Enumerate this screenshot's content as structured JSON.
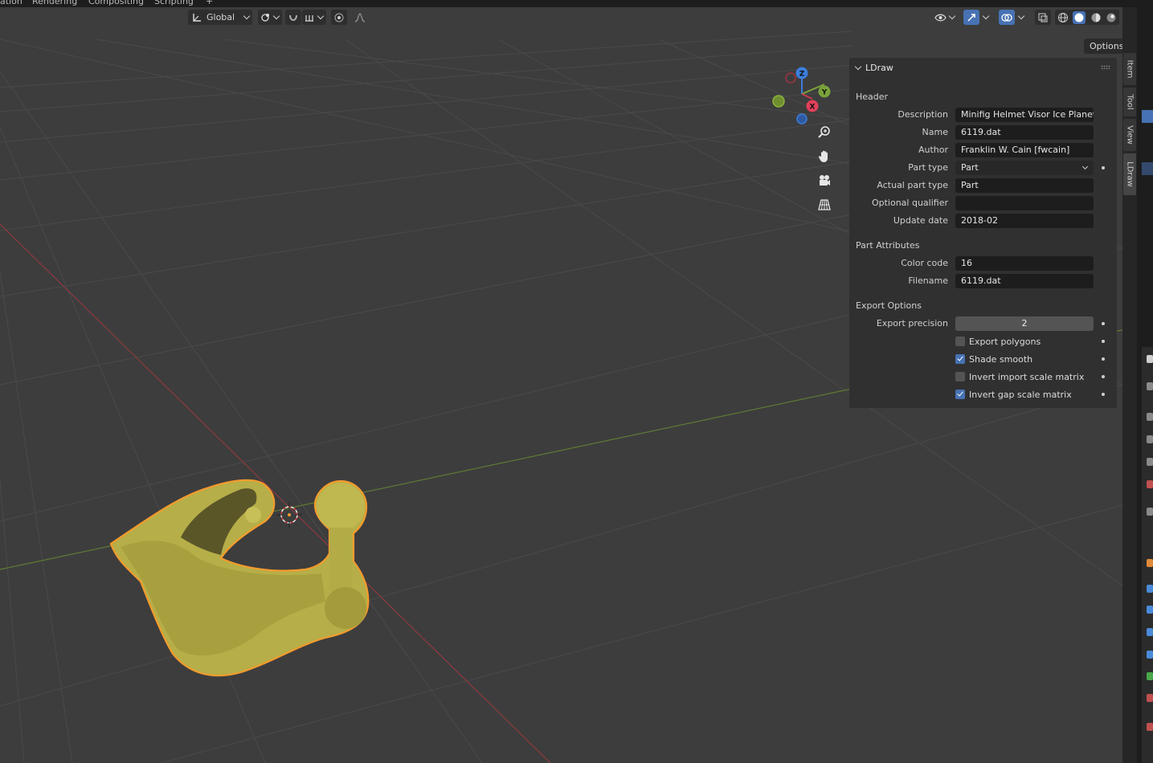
{
  "topbar": {
    "workspaces": [
      "ation",
      "Rendering",
      "Compositing",
      "Scripting",
      "+"
    ]
  },
  "header": {
    "transform_orientation": "Global",
    "options_label": "Options"
  },
  "gizmo": {
    "z": "Z",
    "y": "Y",
    "x": "X"
  },
  "panel": {
    "title": "LDraw",
    "header_section": "Header",
    "fields": [
      {
        "label": "Description",
        "value": "Minifig Helmet Visor Ice Planet"
      },
      {
        "label": "Name",
        "value": "6119.dat"
      },
      {
        "label": "Author",
        "value": "Franklin W. Cain [fwcain]"
      },
      {
        "label": "Part type",
        "value": "Part"
      },
      {
        "label": "Actual part type",
        "value": "Part"
      },
      {
        "label": "Optional qualifier",
        "value": ""
      },
      {
        "label": "Update date",
        "value": "2018-02"
      }
    ],
    "attributes_section": "Part Attributes",
    "attributes": [
      {
        "label": "Color code",
        "value": "16"
      },
      {
        "label": "Filename",
        "value": "6119.dat"
      }
    ],
    "export_section": "Export Options",
    "export_precision_label": "Export precision",
    "export_precision_value": "2",
    "checkboxes": [
      {
        "label": "Export polygons",
        "checked": false
      },
      {
        "label": "Shade smooth",
        "checked": true
      },
      {
        "label": "Invert import scale matrix",
        "checked": false
      },
      {
        "label": "Invert gap scale matrix",
        "checked": true
      }
    ]
  },
  "sidebar_tabs": [
    "Item",
    "Tool",
    "View",
    "LDraw"
  ],
  "colors": {
    "viewport_bg": "#3d3d3d",
    "accent": "#4772b3",
    "object_fill": "#b9b24a",
    "selection_outline": "#f39b2d",
    "axis_x": "#c43c4c",
    "axis_y": "#7aa23a",
    "axis_z": "#3c7ddc"
  }
}
